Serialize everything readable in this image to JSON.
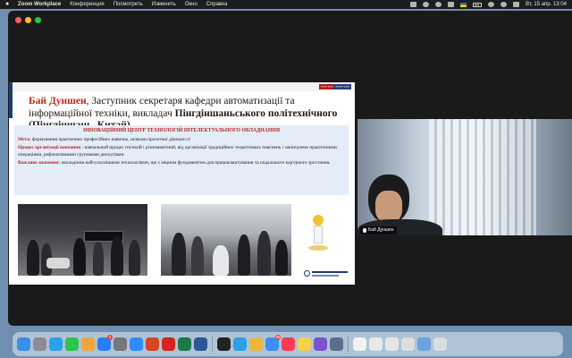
{
  "menubar": {
    "app_name": "Zoom Workplace",
    "menus": [
      "Конференция",
      "Посмотреть",
      "Изменить",
      "Окно",
      "Справка"
    ],
    "clock": "Вт, 15 апр.  13:04"
  },
  "slide": {
    "tags": [
      "???? ????",
      "????? ????"
    ],
    "header": {
      "name": "Бай Дуншен",
      "text1": ", Заступник секретаря кафедри автоматизації та інформаційної техніки, викладач ",
      "bold": "Пінгдіншаньського політехнічного",
      "tail": "(Пінгдіншань, Китай)"
    },
    "info": {
      "title": "ІННОВАЦІЙНИЙ ЦЕНТР ТЕХНОЛОГІЙ ІНТЕЛЕКТУАЛЬНОГО ОБЛАДНАННЯ",
      "items": [
        {
          "key": "Мета:",
          "value": " формування практичних професійних навичок, шляхом проєктної діяльності"
        },
        {
          "key": "Процес організації навчання",
          "value": " : навчальний процес гнучкий і різноманітний, від організації традиційних теоретичних пояснень і закінчуючи практичними операціями, рефлексивними груповими дискусіями."
        },
        {
          "key": "Важливе значення:",
          "value": " оволодіння найсучаснішими технологіями, що є міцним фундаментом для працевлаштування та подальшого кар'єрного зростання."
        }
      ]
    }
  },
  "video": {
    "participant_name": "Бай Дуншен"
  },
  "dock": {
    "apps": [
      {
        "name": "finder",
        "color": "#3a8ee6",
        "badge": ""
      },
      {
        "name": "launchpad",
        "color": "#8c8c96",
        "badge": ""
      },
      {
        "name": "safari",
        "color": "#2aa0ee",
        "badge": ""
      },
      {
        "name": "facetime",
        "color": "#2fc24f",
        "badge": ""
      },
      {
        "name": "photos",
        "color": "#f0a43c",
        "badge": ""
      },
      {
        "name": "app-store",
        "color": "#2a7ff2",
        "badge": "3"
      },
      {
        "name": "settings",
        "color": "#777779",
        "badge": ""
      },
      {
        "name": "zoom",
        "color": "#2d8cff",
        "badge": ""
      },
      {
        "name": "powerpoint",
        "color": "#d24726",
        "badge": ""
      },
      {
        "name": "acrobat",
        "color": "#d4251c",
        "badge": ""
      },
      {
        "name": "excel",
        "color": "#1d7a45",
        "badge": ""
      },
      {
        "name": "word",
        "color": "#2b5797",
        "badge": ""
      },
      {
        "name": "terminal",
        "color": "#222222",
        "badge": ""
      },
      {
        "name": "telegram",
        "color": "#2aa2e0",
        "badge": ""
      },
      {
        "name": "chrome",
        "color": "#e8b53a",
        "badge": ""
      },
      {
        "name": "mail",
        "color": "#3d8ef0",
        "badge": "99"
      },
      {
        "name": "music",
        "color": "#fa3b55",
        "badge": ""
      },
      {
        "name": "notes",
        "color": "#f4d24b",
        "badge": ""
      },
      {
        "name": "viber",
        "color": "#7c52cf",
        "badge": ""
      },
      {
        "name": "preview",
        "color": "#5a6f8c",
        "badge": ""
      },
      {
        "name": "document-1",
        "color": "#f2f2f2",
        "badge": ""
      },
      {
        "name": "document-2",
        "color": "#e9e9e9",
        "badge": ""
      },
      {
        "name": "document-3",
        "color": "#e5e5e5",
        "badge": ""
      },
      {
        "name": "document-4",
        "color": "#dddddd",
        "badge": ""
      },
      {
        "name": "downloads",
        "color": "#6aa3e0",
        "badge": ""
      },
      {
        "name": "trash",
        "color": "#d8dde2",
        "badge": ""
      }
    ]
  }
}
